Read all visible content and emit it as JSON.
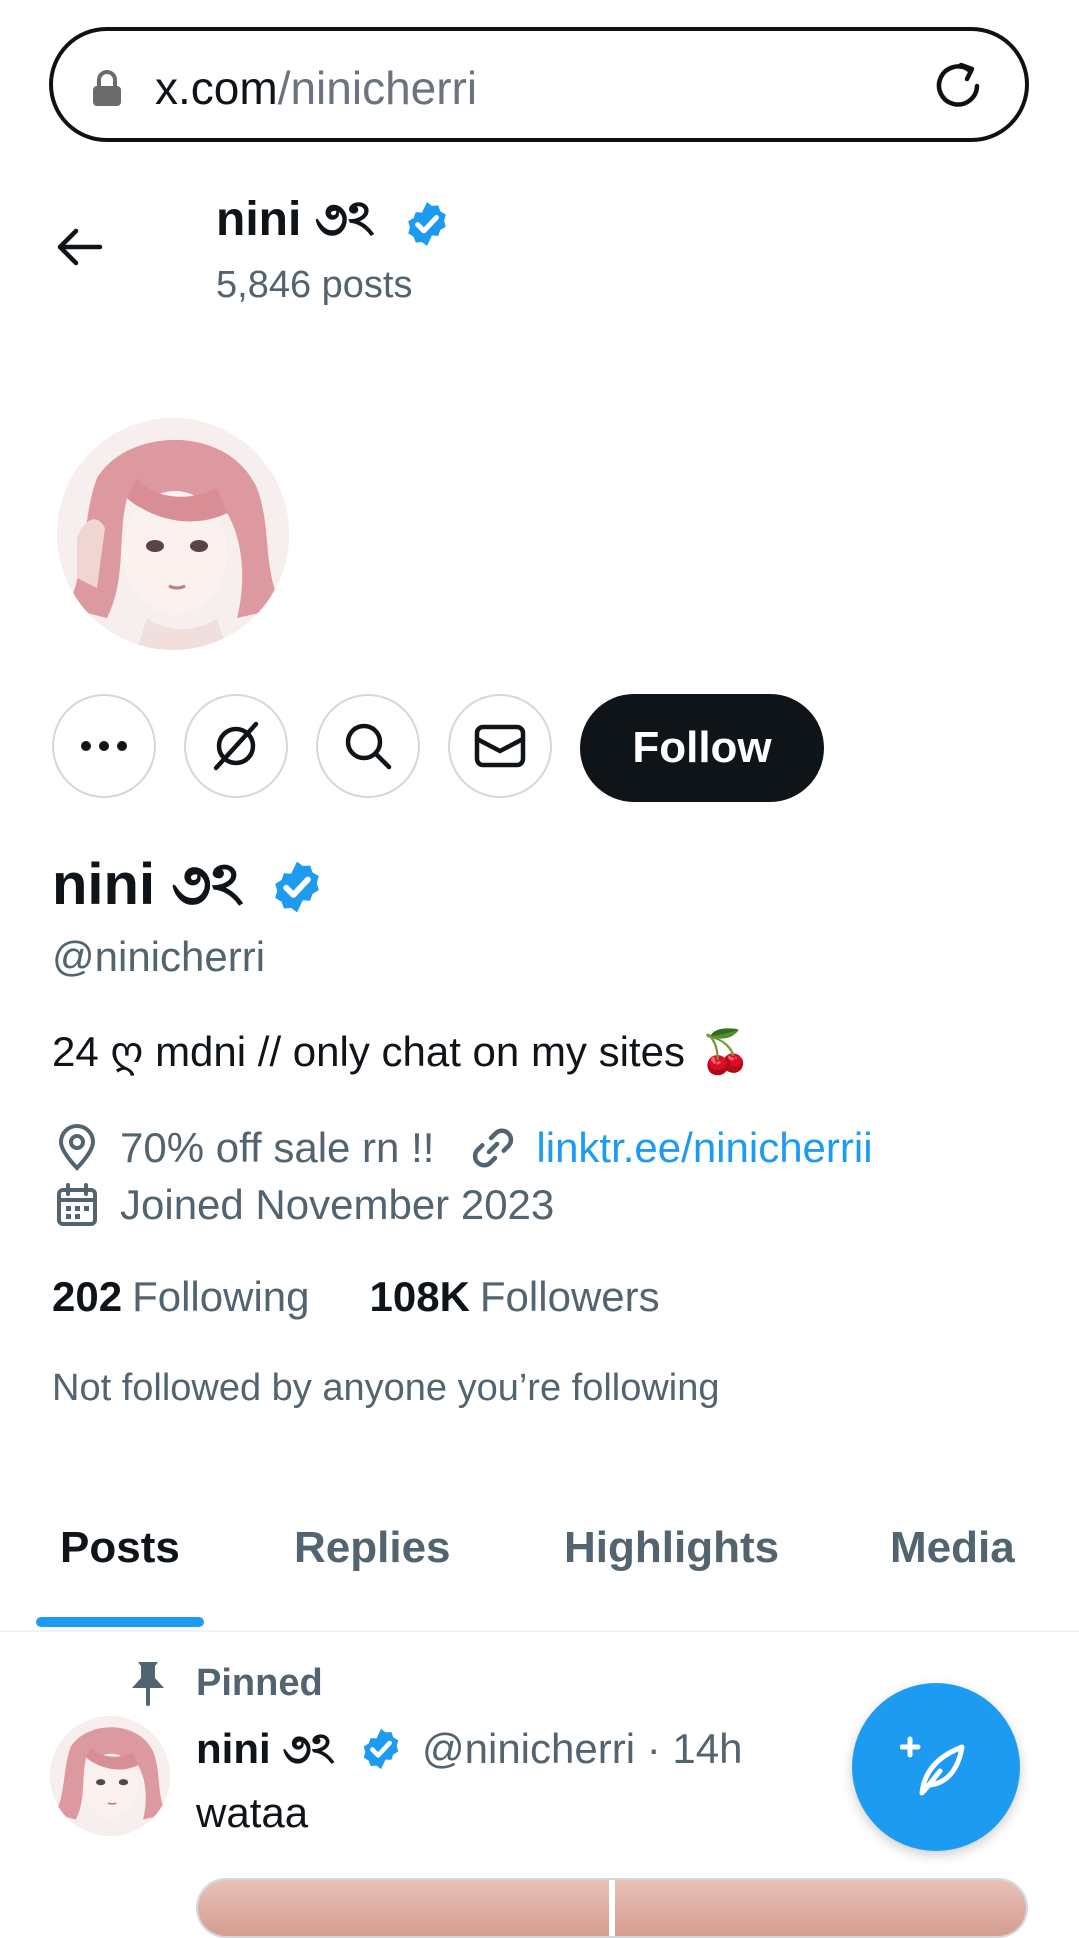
{
  "browser": {
    "url_host": "x.com",
    "url_path": "/ninicherri"
  },
  "header": {
    "name": "nini ૭ঽ",
    "post_count": "5,846 posts"
  },
  "profile": {
    "display_name": "nini ૭ঽ",
    "handle": "@ninicherri",
    "bio_text": "24 ღ mdni // only chat on my sites",
    "bio_emoji": "🍒",
    "location": "70% off sale rn !!",
    "website": "linktr.ee/ninicherrii",
    "joined": "Joined November 2023",
    "following_count": "202",
    "following_label": "Following",
    "followers_count": "108K",
    "followers_label": "Followers",
    "not_followed_text": "Not followed by anyone you’re following",
    "follow_label": "Follow"
  },
  "tabs": [
    {
      "label": "Posts",
      "active": true
    },
    {
      "label": "Replies",
      "active": false
    },
    {
      "label": "Highlights",
      "active": false
    },
    {
      "label": "Media",
      "active": false
    }
  ],
  "pinned_post": {
    "pinned_label": "Pinned",
    "author_name": "nini ૭ঽ",
    "author_handle": "@ninicherri",
    "separator": "·",
    "time": "14h",
    "text": "wataa"
  },
  "icons": {
    "lock": "lock-icon",
    "reload": "reload-icon",
    "back": "arrow-left-icon",
    "verified": "verified-badge-icon",
    "more": "more-horizontal-icon",
    "grok": "grok-icon",
    "search": "search-icon",
    "message": "envelope-icon",
    "location": "location-pin-icon",
    "link": "link-icon",
    "calendar": "calendar-icon",
    "pin": "pin-icon",
    "compose": "compose-post-icon"
  },
  "colors": {
    "accent": "#1d9bf0",
    "text": "#0f1419",
    "muted": "#536471",
    "follow_bg": "#0f1419"
  }
}
